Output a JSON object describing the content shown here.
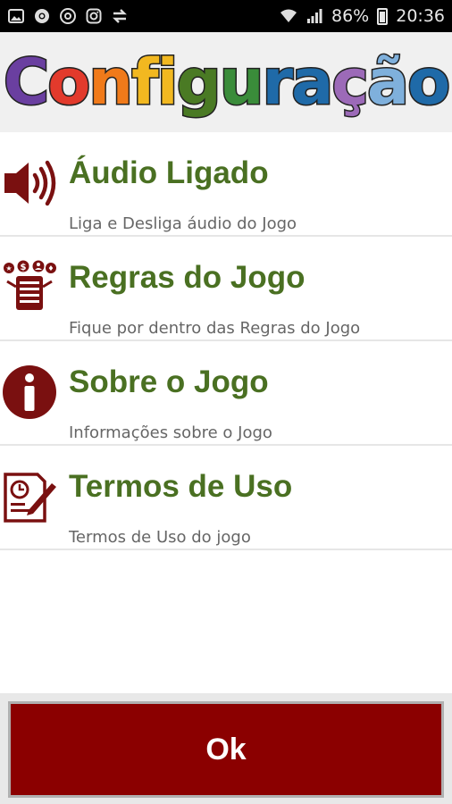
{
  "status_bar": {
    "battery": "86%",
    "time": "20:36",
    "left_icons": [
      "gallery-icon",
      "chrome-icon",
      "sync-icon",
      "instagram-icon",
      "transfer-icon"
    ],
    "right_icons": [
      "wifi-icon",
      "signal-icon",
      "battery-icon"
    ]
  },
  "header": {
    "title": "Configuração",
    "letter_colors": [
      "#6a3fa0",
      "#e23a2c",
      "#f07a1a",
      "#f2b820",
      "#f2b820",
      "#4a7a24",
      "#3a8c3a",
      "#1f6aa8",
      "#1f6aa8",
      "#9c6ab8",
      "#7fb0dc",
      "#1f6aa8"
    ]
  },
  "menu": {
    "items": [
      {
        "title": "Áudio Ligado",
        "subtitle": "Liga e Desliga áudio do Jogo",
        "icon": "speaker-icon"
      },
      {
        "title": "Regras do Jogo",
        "subtitle": "Fique por dentro das Regras do Jogo",
        "icon": "rules-icon"
      },
      {
        "title": "Sobre o Jogo",
        "subtitle": "Informações sobre o Jogo",
        "icon": "info-icon"
      },
      {
        "title": "Termos de Uso",
        "subtitle": "Termos de Uso do jogo",
        "icon": "terms-icon"
      }
    ]
  },
  "footer": {
    "ok_label": "Ok"
  },
  "colors": {
    "accent": "#8b0000",
    "title_green": "#4a7022",
    "icon_color": "#7a1010"
  }
}
